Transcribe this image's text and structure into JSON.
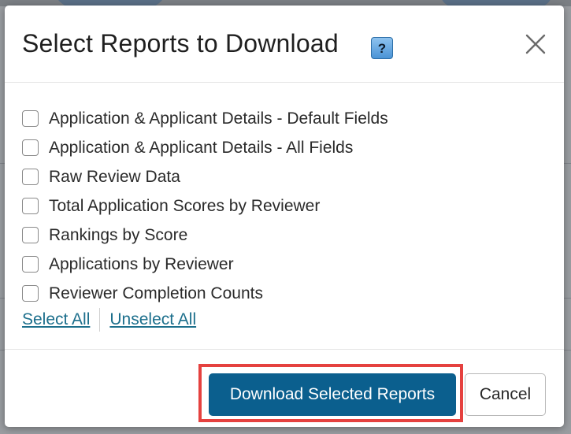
{
  "modal": {
    "title": "Select Reports to Download",
    "help_icon_glyph": "?",
    "close_icon": "close-icon"
  },
  "options": [
    {
      "label": "Application & Applicant Details - Default Fields",
      "checked": false
    },
    {
      "label": "Application & Applicant Details - All Fields",
      "checked": false
    },
    {
      "label": "Raw Review Data",
      "checked": false
    },
    {
      "label": "Total Application Scores by Reviewer",
      "checked": false
    },
    {
      "label": "Rankings by Score",
      "checked": false
    },
    {
      "label": "Applications by Reviewer",
      "checked": false
    },
    {
      "label": "Reviewer Completion Counts",
      "checked": false
    }
  ],
  "links": {
    "select_all": "Select All",
    "unselect_all": "Unselect All"
  },
  "footer": {
    "download_label": "Download Selected Reports",
    "cancel_label": "Cancel"
  },
  "colors": {
    "primary": "#0b5f8e",
    "link": "#1c6f8c",
    "highlight": "#e5413f"
  }
}
